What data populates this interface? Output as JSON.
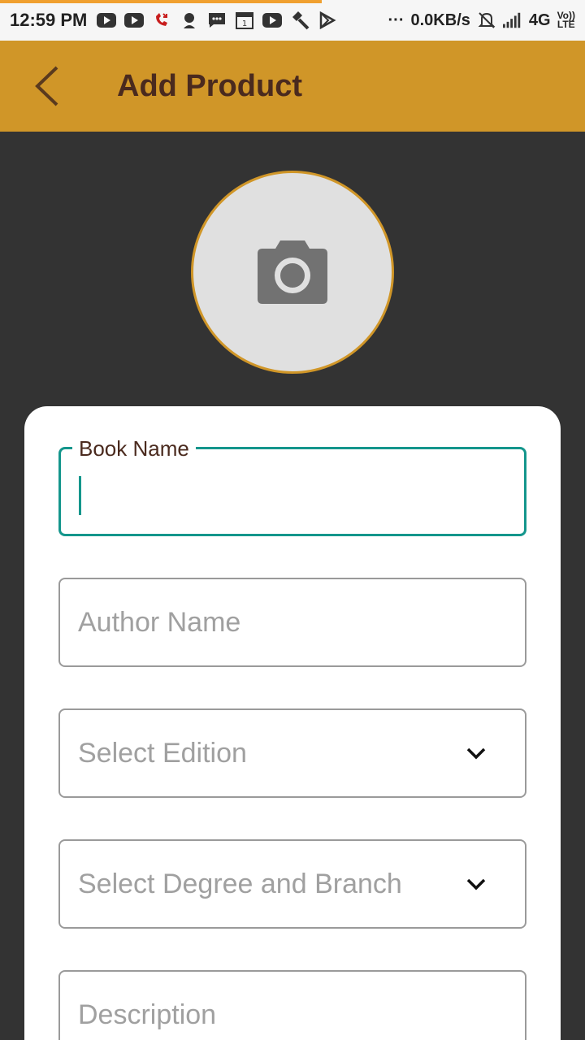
{
  "status_bar": {
    "time": "12:59 PM",
    "net_speed": "0.0KB/s",
    "network": "4G",
    "volte_top": "Vo))",
    "volte_bottom": "LTE",
    "more": "···",
    "icons": [
      "youtube-icon",
      "youtube-icon",
      "missed-call-icon",
      "person-icon",
      "message-icon",
      "calendar-icon",
      "youtube-icon",
      "hammer-icon",
      "play-store-icon"
    ]
  },
  "app_bar": {
    "back_icon": "chevron-left-icon",
    "title": "Add Product"
  },
  "photo": {
    "icon": "camera-icon"
  },
  "form": {
    "book_name": {
      "label": "Book Name",
      "value": ""
    },
    "author_name": {
      "placeholder": "Author Name"
    },
    "edition": {
      "placeholder": "Select Edition",
      "icon": "chevron-down-icon"
    },
    "degree_branch": {
      "placeholder": "Select Degree and Branch",
      "icon": "chevron-down-icon"
    },
    "description": {
      "placeholder": "Description"
    }
  },
  "colors": {
    "accent": "#d09628",
    "focus": "#14968c",
    "title": "#4a2a1e",
    "background": "#333333"
  }
}
